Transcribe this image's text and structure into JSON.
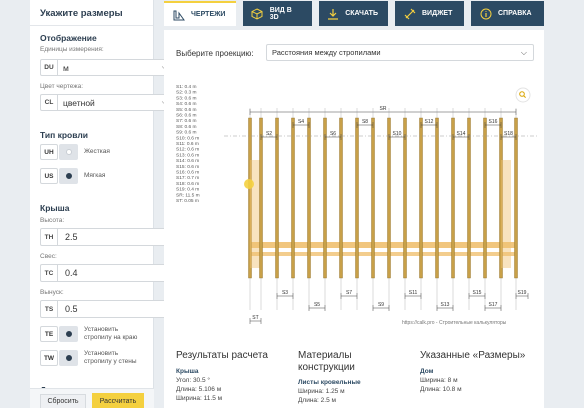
{
  "sidebar": {
    "title": "Укажите размеры",
    "display": {
      "section": "Отображение",
      "units_label": "Единицы измерения:",
      "units_code": "DU",
      "units_value": "м",
      "color_label": "Цвет чертежа:",
      "color_code": "CL",
      "color_value": "цветной"
    },
    "roof_type": {
      "section": "Тип кровли",
      "rigid_code": "UH",
      "rigid_label": "Жесткая",
      "soft_code": "US",
      "soft_label": "Мягкая"
    },
    "roof": {
      "section": "Крыша",
      "height_label": "Высота:",
      "height_code": "TH",
      "height_value": "2.5",
      "overhang_label": "Свес:",
      "overhang_code": "TC",
      "overhang_value": "0.4",
      "offset_label": "Вынуск:",
      "offset_code": "TS",
      "offset_value": "0.5",
      "edge_code": "TE",
      "edge_label": "Установить стропилу на краю",
      "wall_code": "TW",
      "wall_label": "Установить стропилу у стены"
    },
    "house_section": "Дом",
    "reset_label": "Сбросить",
    "calc_label": "Рассчитать"
  },
  "tabs": [
    {
      "label": "ЧЕРТЕЖИ",
      "icon": "blueprint-icon"
    },
    {
      "label": "ВИД В 3D",
      "icon": "cube-icon"
    },
    {
      "label": "СКАЧАТЬ",
      "icon": "download-icon"
    },
    {
      "label": "ВИДЖЕТ",
      "icon": "code-icon"
    },
    {
      "label": "СПРАВКА",
      "icon": "info-icon"
    }
  ],
  "projection": {
    "label": "Выберите проекцию:",
    "value": "Расстояния между стропилами"
  },
  "drawing": {
    "legend": [
      "S1: 0.4 m",
      "S2: 0.3 m",
      "S3: 0.6 m",
      "S4: 0.6 m",
      "S5: 0.6 m",
      "S6: 0.6 m",
      "S7: 0.6 m",
      "S8: 0.6 m",
      "S9: 0.6 m",
      "S10: 0.6 m",
      "S11: 0.6 m",
      "S12: 0.6 m",
      "S13: 0.6 m",
      "S14: 0.6 m",
      "S15: 0.6 m",
      "S16: 0.6 m",
      "S17: 0.7 m",
      "S18: 0.6 m",
      "S19: 0.4 m",
      "SR: 11.5 m",
      "ST: 0.05 m"
    ],
    "top_label": "SR",
    "top_row1": [
      "S4",
      "S8",
      "S12",
      "S16"
    ],
    "top_row2": [
      "S2",
      "S6",
      "S10",
      "S14",
      "S18"
    ],
    "bottom_row1": [
      "S3",
      "S7",
      "S11",
      "S15",
      "S19"
    ],
    "bottom_row2": [
      "S5",
      "S9",
      "S13",
      "S17"
    ],
    "st_label": "ST",
    "credit": "https://calk.pro - Строительные калькуляторы",
    "colors": {
      "rafter": "#c8a048",
      "rafter_stroke": "#8a6a20",
      "beam": "#f0c070",
      "dim": "#444444"
    }
  },
  "results": {
    "col1": {
      "heading": "Результаты расчета",
      "sub": "Крыша",
      "lines": [
        "Угол: 30.5 °",
        "Длина: 5.106 м",
        "Ширина: 11.5 м"
      ]
    },
    "col2": {
      "heading": "Материалы конструкции",
      "sub": "Листы кровельные",
      "lines": [
        "Ширина: 1.25 м",
        "Длина: 2.5 м"
      ]
    },
    "col3": {
      "heading": "Указанные «Размеры»",
      "sub": "Дом",
      "lines": [
        "Ширина: 8 м",
        "Длина: 10.8 м"
      ]
    }
  }
}
